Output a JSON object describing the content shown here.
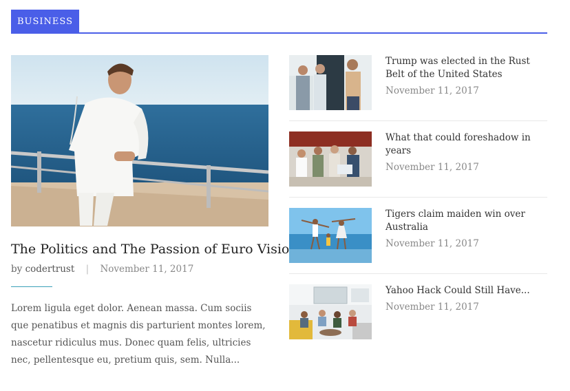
{
  "section": {
    "label": "BUSINESS",
    "accent_color": "#4a5ee8"
  },
  "featured": {
    "title": "The Politics and The Passion of Euro Visions",
    "by": "by",
    "author": "codertrust",
    "date": "November 11, 2017",
    "excerpt": "Lorem ligula eget dolor. Aenean massa. Cum sociis que penatibus et magnis dis parturient montes lorem, nascetur ridiculus mus. Donec quam felis, ultricies nec, pellentesque eu, pretium quis, sem. Nulla..."
  },
  "side_posts": [
    {
      "title": "Trump was elected in the Rust Belt of the United States",
      "date": "November 11, 2017"
    },
    {
      "title": "What that could foreshadow in years",
      "date": "November 11, 2017"
    },
    {
      "title": "Tigers claim maiden win over Australia",
      "date": "November 11, 2017"
    },
    {
      "title": "Yahoo Hack Could Still Have...",
      "date": "November 11, 2017"
    }
  ]
}
